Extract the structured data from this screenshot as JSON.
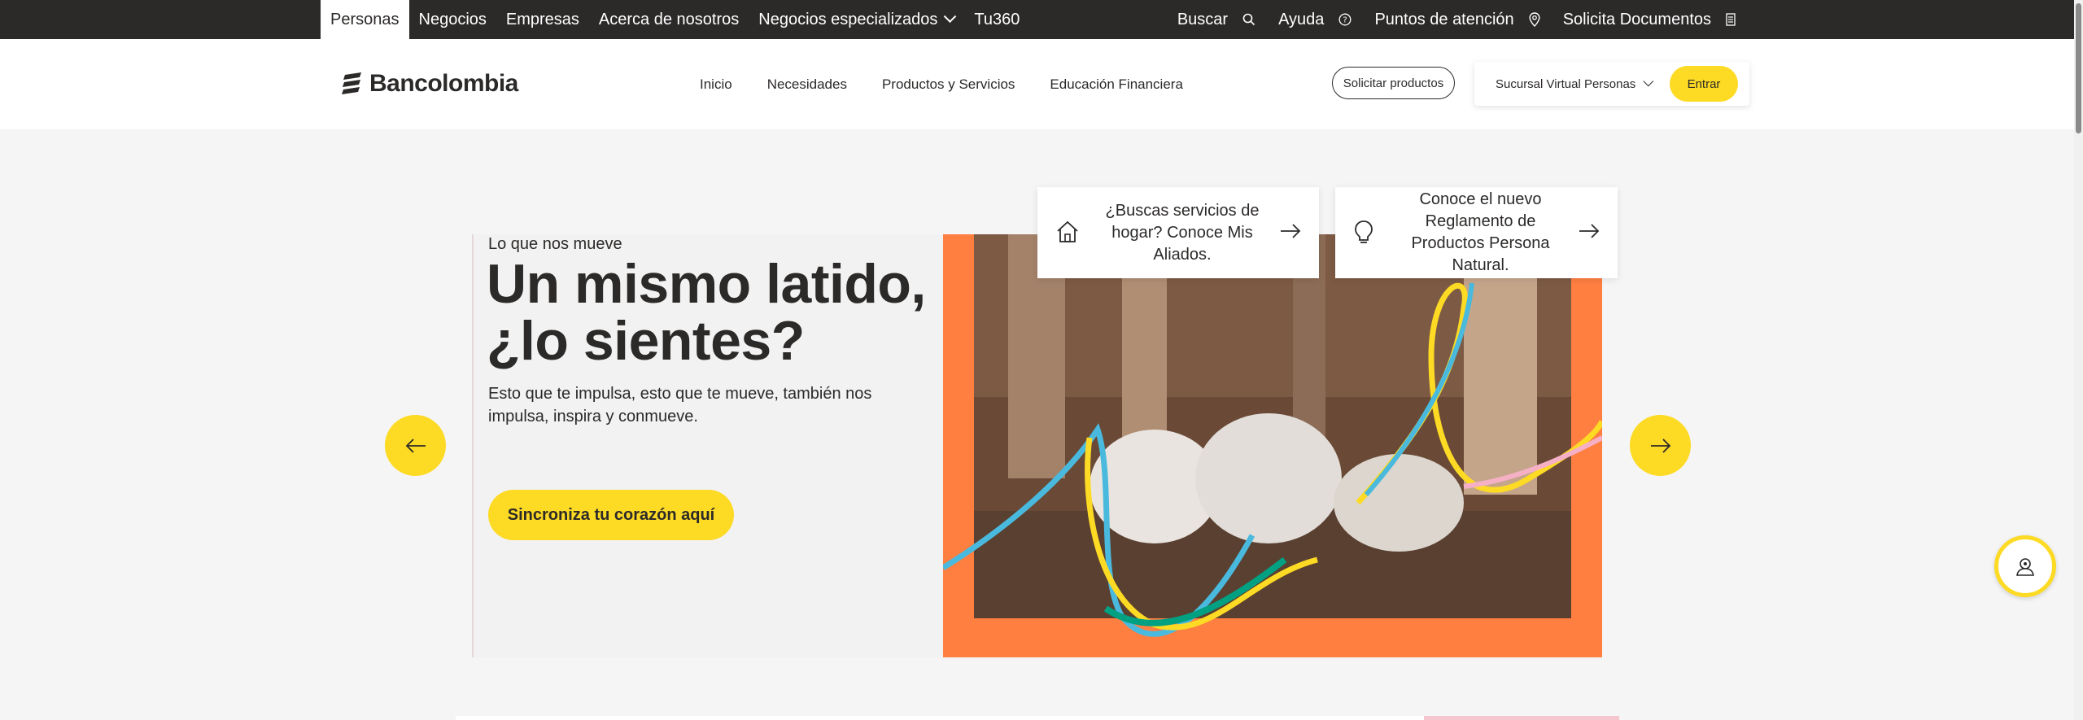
{
  "topbar": {
    "tabs": [
      {
        "label": "Personas"
      },
      {
        "label": "Negocios"
      },
      {
        "label": "Empresas"
      },
      {
        "label": "Acerca de nosotros"
      },
      {
        "label": "Negocios especializados"
      },
      {
        "label": "Tu360"
      }
    ],
    "active_tab": "Personas",
    "right": {
      "search": "Buscar",
      "help": "Ayuda",
      "points": "Puntos de atención",
      "docs": "Solicita Documentos"
    }
  },
  "header": {
    "logo": "Bancolombia",
    "nav": [
      "Inicio",
      "Necesidades",
      "Productos y Servicios",
      "Educación Financiera"
    ],
    "solicitar": "Solicitar productos",
    "sucursal": "Sucursal Virtual Personas",
    "entrar": "Entrar"
  },
  "hero": {
    "eyebrow": "Lo que nos mueve",
    "title_line1": "Un mismo latido,",
    "title_line2": "¿lo sientes?",
    "description": "Esto que te impulsa, esto que te mueve, también nos impulsa, inspira y conmueve.",
    "cta": "Sincroniza tu corazón aquí"
  },
  "cards": [
    {
      "text": "¿Buscas servicios de hogar? Conoce Mis Aliados.",
      "icon": "home-icon"
    },
    {
      "text": "Conoce el nuevo Reglamento de Productos Persona Natural.",
      "icon": "lightbulb-icon"
    }
  ],
  "colors": {
    "brand_yellow": "#fdda24",
    "dark": "#2c2a29",
    "hero_orange": "#ff7f41"
  }
}
